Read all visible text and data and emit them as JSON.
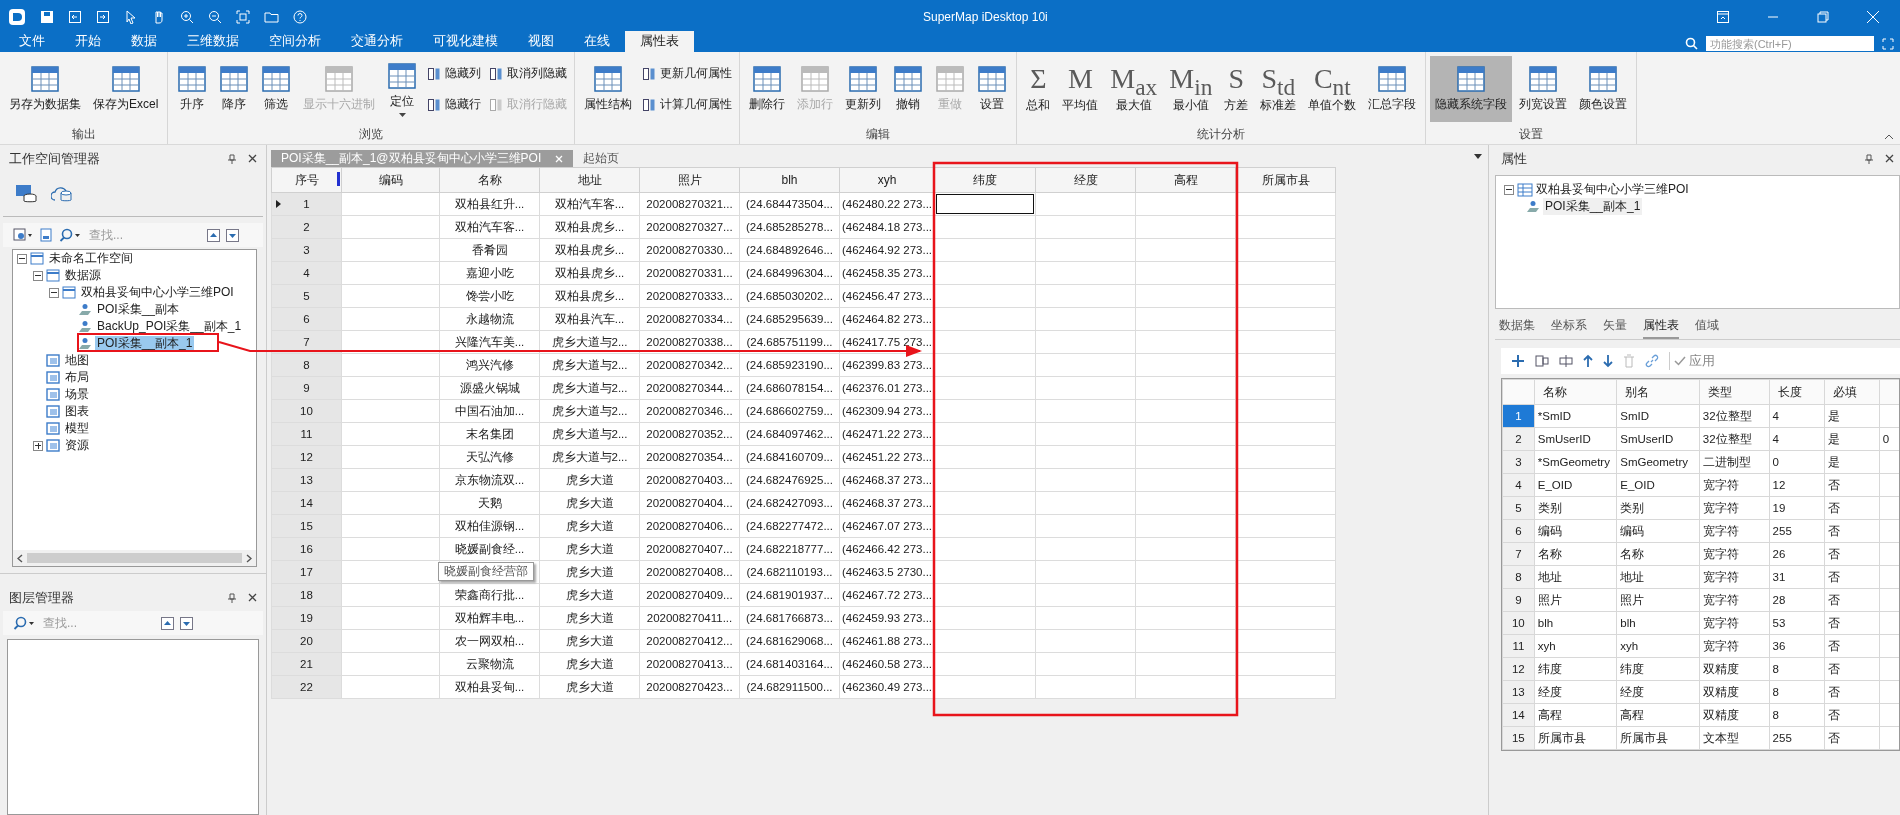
{
  "window": {
    "title": "SuperMap iDesktop 10i"
  },
  "search": {
    "placeholder": "功能搜索(Ctrl+F)"
  },
  "ribbon_tabs": [
    {
      "label": "文件",
      "selected": false
    },
    {
      "label": "开始",
      "selected": false
    },
    {
      "label": "数据",
      "selected": false
    },
    {
      "label": "三维数据",
      "selected": false
    },
    {
      "label": "空间分析",
      "selected": false
    },
    {
      "label": "交通分析",
      "selected": false
    },
    {
      "label": "可视化建模",
      "selected": false
    },
    {
      "label": "视图",
      "selected": false
    },
    {
      "label": "在线",
      "selected": false
    },
    {
      "label": "属性表",
      "selected": true
    }
  ],
  "ribbon": {
    "groups": [
      {
        "label": "输出",
        "items": [
          {
            "kind": "large",
            "label": "另存为数据集",
            "disabled": false
          },
          {
            "kind": "large",
            "label": "保存为Excel",
            "disabled": false
          }
        ]
      },
      {
        "label": "浏览",
        "items": [
          {
            "kind": "large",
            "label": "升序",
            "disabled": false
          },
          {
            "kind": "large",
            "label": "降序",
            "disabled": false
          },
          {
            "kind": "large",
            "label": "筛选",
            "disabled": false
          },
          {
            "kind": "large",
            "label": "显示十六进制",
            "disabled": true
          },
          {
            "kind": "large",
            "label": "定位",
            "disabled": false,
            "dropdown": true
          },
          {
            "kind": "stack",
            "items": [
              {
                "label": "隐藏列",
                "disabled": false
              },
              {
                "label": "隐藏行",
                "disabled": false
              }
            ]
          },
          {
            "kind": "stack",
            "items": [
              {
                "label": "取消列隐藏",
                "disabled": false
              },
              {
                "label": "取消行隐藏",
                "disabled": true
              }
            ]
          }
        ]
      },
      {
        "items": [
          {
            "kind": "large",
            "label": "属性结构",
            "disabled": false
          },
          {
            "kind": "stack",
            "items": [
              {
                "label": "更新几何属性",
                "disabled": false
              },
              {
                "label": "计算几何属性",
                "disabled": false
              }
            ]
          }
        ]
      },
      {
        "label": "编辑",
        "items": [
          {
            "kind": "large",
            "label": "删除行",
            "disabled": false
          },
          {
            "kind": "large",
            "label": "添加行",
            "disabled": true
          },
          {
            "kind": "large",
            "label": "更新列",
            "disabled": false
          },
          {
            "kind": "large",
            "label": "撤销",
            "disabled": false
          },
          {
            "kind": "large",
            "label": "重做",
            "disabled": true
          },
          {
            "kind": "large",
            "label": "设置",
            "disabled": false
          }
        ]
      },
      {
        "label": "统计分析",
        "items": [
          {
            "kind": "large",
            "label": "总和",
            "glyph": "Σ",
            "disabled": false
          },
          {
            "kind": "large",
            "label": "平均值",
            "glyph": "M",
            "disabled": false
          },
          {
            "kind": "large",
            "label": "最大值",
            "glyph": "M$_{ax}$",
            "disabled": false
          },
          {
            "kind": "large",
            "label": "最小值",
            "glyph": "M$_{in}$",
            "disabled": false
          },
          {
            "kind": "large",
            "label": "方差",
            "glyph": "S",
            "disabled": false
          },
          {
            "kind": "large",
            "label": "标准差",
            "glyph": "S$_{td}$",
            "disabled": false
          },
          {
            "kind": "large",
            "label": "单值个数",
            "glyph": "C$_{nt}$",
            "disabled": false
          },
          {
            "kind": "large",
            "label": "汇总字段",
            "disabled": false
          }
        ]
      },
      {
        "label": "设置",
        "items": [
          {
            "kind": "large",
            "label": "隐藏系统字段",
            "disabled": false,
            "pressed": true
          },
          {
            "kind": "large",
            "label": "列宽设置",
            "disabled": false,
            "pressed": false
          },
          {
            "kind": "large",
            "label": "颜色设置",
            "disabled": false,
            "pressed": false
          }
        ]
      }
    ]
  },
  "workspace": {
    "title": "工作空间管理器",
    "search_placeholder": "查找...",
    "tree": [
      {
        "label": "未命名工作空间",
        "expanded": true,
        "selected": false,
        "children": [
          {
            "label": "数据源",
            "expanded": true,
            "selected": false,
            "children": [
              {
                "label": "双柏县妥甸中心小学三维POI",
                "expanded": true,
                "selected": false,
                "children": [
                  {
                    "label": "POI采集__副本",
                    "selected": false
                  },
                  {
                    "label": "BackUp_POI采集__副本_1",
                    "selected": false
                  },
                  {
                    "label": "POI采集__副本_1",
                    "selected": true
                  }
                ]
              }
            ]
          },
          {
            "label": "地图",
            "selected": false
          },
          {
            "label": "布局",
            "selected": false
          },
          {
            "label": "场景",
            "selected": false
          },
          {
            "label": "图表",
            "selected": false
          },
          {
            "label": "模型",
            "selected": false
          },
          {
            "label": "资源",
            "expanded": false,
            "selected": false
          }
        ]
      }
    ]
  },
  "layers": {
    "title": "图层管理器",
    "search_placeholder": "查找..."
  },
  "doc_tabs": [
    {
      "label": "POI采集__副本_1@双柏县妥甸中心小学三维POI",
      "selected": true
    },
    {
      "label": "起始页",
      "selected": false
    }
  ],
  "table": {
    "columns": [
      "序号",
      "编码",
      "名称",
      "地址",
      "照片",
      "blh",
      "xyh",
      "纬度",
      "经度",
      "高程",
      "所属市县"
    ],
    "rows": [
      {
        "no": "1",
        "name": "双柏县红升...",
        "address": "双柏汽车客...",
        "photo": "202008270321...",
        "blh": "(24.684473504...",
        "xyh": "(462480.22 273...",
        "selected": true
      },
      {
        "no": "2",
        "name": "双柏汽车客...",
        "address": "双柏县虎乡...",
        "photo": "202008270327...",
        "blh": "(24.685285278...",
        "xyh": "(462484.18 273...",
        "selected": false
      },
      {
        "no": "3",
        "name": "香肴园",
        "address": "双柏县虎乡...",
        "photo": "202008270330...",
        "blh": "(24.684892646...",
        "xyh": "(462464.92 273...",
        "selected": false
      },
      {
        "no": "4",
        "name": "嘉迎小吃",
        "address": "双柏县虎乡...",
        "photo": "202008270331...",
        "blh": "(24.684996304...",
        "xyh": "(462458.35 273...",
        "selected": false
      },
      {
        "no": "5",
        "name": "馋尝小吃",
        "address": "双柏县虎乡...",
        "photo": "202008270333...",
        "blh": "(24.685030202...",
        "xyh": "(462456.47 273...",
        "selected": false
      },
      {
        "no": "6",
        "name": "永越物流",
        "address": "双柏县汽车...",
        "photo": "202008270334...",
        "blh": "(24.685295639...",
        "xyh": "(462464.82 273...",
        "selected": false
      },
      {
        "no": "7",
        "name": "兴隆汽车美...",
        "address": "虎乡大道与2...",
        "photo": "202008270338...",
        "blh": "(24.685751199...",
        "xyh": "(462417.75 273...",
        "selected": false
      },
      {
        "no": "8",
        "name": "鸿兴汽修",
        "address": "虎乡大道与2...",
        "photo": "202008270342...",
        "blh": "(24.685923190...",
        "xyh": "(462399.83 273...",
        "selected": false
      },
      {
        "no": "9",
        "name": "源盛火锅城",
        "address": "虎乡大道与2...",
        "photo": "202008270344...",
        "blh": "(24.686078154...",
        "xyh": "(462376.01 273...",
        "selected": false
      },
      {
        "no": "10",
        "name": "中国石油加...",
        "address": "虎乡大道与2...",
        "photo": "202008270346...",
        "blh": "(24.686602759...",
        "xyh": "(462309.94 273...",
        "selected": false
      },
      {
        "no": "11",
        "name": "末名集团",
        "address": "虎乡大道与2...",
        "photo": "202008270352...",
        "blh": "(24.684097462...",
        "xyh": "(462471.22 273...",
        "selected": false
      },
      {
        "no": "12",
        "name": "天弘汽修",
        "address": "虎乡大道与2...",
        "photo": "202008270354...",
        "blh": "(24.684160709...",
        "xyh": "(462451.22 273...",
        "selected": false
      },
      {
        "no": "13",
        "name": "京东物流双...",
        "address": "虎乡大道",
        "photo": "202008270403...",
        "blh": "(24.682476925...",
        "xyh": "(462468.37 273...",
        "selected": false
      },
      {
        "no": "14",
        "name": "天鹅",
        "address": "虎乡大道",
        "photo": "202008270404...",
        "blh": "(24.682427093...",
        "xyh": "(462468.37 273...",
        "selected": false
      },
      {
        "no": "15",
        "name": "双柏佳源钢...",
        "address": "虎乡大道",
        "photo": "202008270406...",
        "blh": "(24.682277472...",
        "xyh": "(462467.07 273...",
        "selected": false
      },
      {
        "no": "16",
        "name": "晓媛副食经...",
        "address": "虎乡大道",
        "photo": "202008270407...",
        "blh": "(24.682218777...",
        "xyh": "(462466.42 273...",
        "selected": false
      },
      {
        "no": "17",
        "tooltip": "晓媛副食经营部",
        "address": "虎乡大道",
        "photo": "202008270408...",
        "blh": "(24.682110193...",
        "xyh": "(462463.5 2730...",
        "selected": false
      },
      {
        "no": "18",
        "name": "荣鑫商行批...",
        "address": "虎乡大道",
        "photo": "202008270409...",
        "blh": "(24.681901937...",
        "xyh": "(462467.72 273...",
        "selected": false
      },
      {
        "no": "19",
        "name": "双柏辉丰电...",
        "address": "虎乡大道",
        "photo": "202008270411...",
        "blh": "(24.681766873...",
        "xyh": "(462459.93 273...",
        "selected": false
      },
      {
        "no": "20",
        "name": "农一网双柏...",
        "address": "虎乡大道",
        "photo": "202008270412...",
        "blh": "(24.681629068...",
        "xyh": "(462461.88 273...",
        "selected": false
      },
      {
        "no": "21",
        "name": "云聚物流",
        "address": "虎乡大道",
        "photo": "202008270413...",
        "blh": "(24.681403164...",
        "xyh": "(462460.58 273...",
        "selected": false
      },
      {
        "no": "22",
        "name": "双柏县妥甸...",
        "address": "虎乡大道",
        "photo": "202008270423...",
        "blh": "(24.682911500...",
        "xyh": "(462360.49 273...",
        "selected": false
      }
    ]
  },
  "properties": {
    "title": "属性",
    "tree": {
      "label": "双柏县妥甸中心小学三维POI",
      "child": "POI采集__副本_1"
    },
    "tabs": [
      {
        "label": "数据集",
        "selected": false
      },
      {
        "label": "坐标系",
        "selected": false
      },
      {
        "label": "矢量",
        "selected": false
      },
      {
        "label": "属性表",
        "selected": true
      },
      {
        "label": "值域",
        "selected": false
      }
    ],
    "apply_label": "应用",
    "columns": [
      "名称",
      "别名",
      "类型",
      "长度",
      "必填"
    ],
    "fields": [
      {
        "no": "1",
        "name": "*SmID",
        "alias": "SmID",
        "type": "32位整型",
        "length": "4",
        "required": "是",
        "selected": true
      },
      {
        "no": "2",
        "name": "SmUserID",
        "alias": "SmUserID",
        "type": "32位整型",
        "length": "4",
        "required": "是",
        "column_7": "0",
        "selected": false
      },
      {
        "no": "3",
        "name": "*SmGeometry",
        "alias": "SmGeometry",
        "type": "二进制型",
        "length": "0",
        "required": "是",
        "selected": false
      },
      {
        "no": "4",
        "name": "E_OID",
        "alias": "E_OID",
        "type": "宽字符",
        "length": "12",
        "required": "否",
        "selected": false
      },
      {
        "no": "5",
        "name": "类别",
        "alias": "类别",
        "type": "宽字符",
        "length": "19",
        "required": "否",
        "selected": false
      },
      {
        "no": "6",
        "name": "编码",
        "alias": "编码",
        "type": "宽字符",
        "length": "255",
        "required": "否",
        "selected": false
      },
      {
        "no": "7",
        "name": "名称",
        "alias": "名称",
        "type": "宽字符",
        "length": "26",
        "required": "否",
        "selected": false
      },
      {
        "no": "8",
        "name": "地址",
        "alias": "地址",
        "type": "宽字符",
        "length": "31",
        "required": "否",
        "selected": false
      },
      {
        "no": "9",
        "name": "照片",
        "alias": "照片",
        "type": "宽字符",
        "length": "28",
        "required": "否",
        "selected": false
      },
      {
        "no": "10",
        "name": "blh",
        "alias": "blh",
        "type": "宽字符",
        "length": "53",
        "required": "否",
        "selected": false
      },
      {
        "no": "11",
        "name": "xyh",
        "alias": "xyh",
        "type": "宽字符",
        "length": "36",
        "required": "否",
        "selected": false
      },
      {
        "no": "12",
        "name": "纬度",
        "alias": "纬度",
        "type": "双精度",
        "length": "8",
        "required": "否",
        "selected": false
      },
      {
        "no": "13",
        "name": "经度",
        "alias": "经度",
        "type": "双精度",
        "length": "8",
        "required": "否",
        "selected": false
      },
      {
        "no": "14",
        "name": "高程",
        "alias": "高程",
        "type": "双精度",
        "length": "8",
        "required": "否",
        "selected": false
      },
      {
        "no": "15",
        "name": "所属市县",
        "alias": "所属市县",
        "type": "文本型",
        "length": "255",
        "required": "否",
        "selected": false
      }
    ]
  }
}
